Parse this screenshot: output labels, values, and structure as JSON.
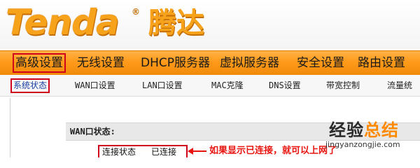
{
  "header": {
    "logo_text": "Tenda",
    "logo_reg": "®",
    "logo_cn": "腾达"
  },
  "main_nav": {
    "items": [
      {
        "label": "高级设置",
        "active": true
      },
      {
        "label": "无线设置",
        "active": false
      },
      {
        "label": "DHCP服务器",
        "active": false
      },
      {
        "label": "虚拟服务器",
        "active": false
      },
      {
        "label": "安全设置",
        "active": false
      },
      {
        "label": "路由设置",
        "active": false
      }
    ]
  },
  "sub_nav": {
    "items": [
      {
        "label": "系统状态",
        "active": true
      },
      {
        "label": "WAN口设置",
        "active": false
      },
      {
        "label": "LAN口设置",
        "active": false
      },
      {
        "label": "MAC克隆",
        "active": false
      },
      {
        "label": "DNS设置",
        "active": false
      },
      {
        "label": "带宽控制",
        "active": false
      },
      {
        "label": "流量统",
        "active": false
      }
    ]
  },
  "wan_status": {
    "title": "WAN口状态:",
    "rows": [
      {
        "label": "连接状态",
        "value": "已连接"
      }
    ]
  },
  "annotation": {
    "text": "如果显示已连接，就可以上网了"
  },
  "watermark": {
    "cn_part1": "经验",
    "cn_part2": "总结",
    "url": "jingyanzongjie.com"
  },
  "colors": {
    "brand_orange": "#f7a21b",
    "nav_orange": "#ff9a1a",
    "highlight_red": "#d0021b"
  }
}
